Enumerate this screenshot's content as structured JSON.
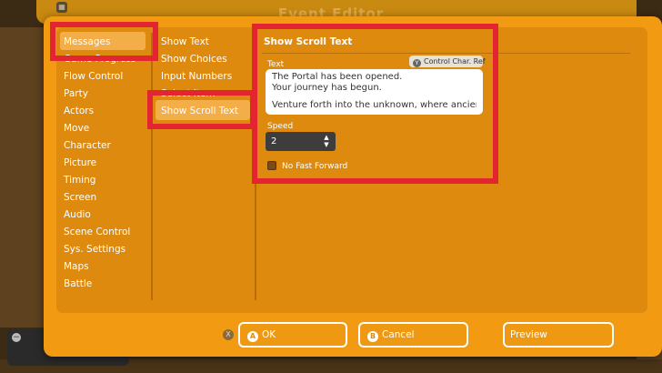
{
  "window": {
    "title": "Event Editor"
  },
  "categories": [
    "Messages",
    "Game Progress",
    "Flow Control",
    "Party",
    "Actors",
    "Move",
    "Character",
    "Picture",
    "Timing",
    "Screen",
    "Audio",
    "Scene Control",
    "Sys. Settings",
    "Maps",
    "Battle"
  ],
  "selected_category": "Messages",
  "commands": [
    "Show Text",
    "Show Choices",
    "Input Numbers",
    "Select Item",
    "Show Scroll Text"
  ],
  "selected_command": "Show Scroll Text",
  "detail": {
    "title": "Show Scroll Text",
    "text_label": "Text",
    "control_ref_button": "Control Char. Ref",
    "control_ref_glyph": "Y",
    "text_lines": [
      "The Portal has been opened.",
      "Your journey has begun.",
      "",
      "Venture forth into the unknown, where ancient …"
    ],
    "speed_label": "Speed",
    "speed_value": "2",
    "no_fast_forward_label": "No Fast Forward",
    "no_fast_forward_checked": false
  },
  "footer": {
    "close_glyph": "X",
    "ok_glyph": "A",
    "ok_label": "OK",
    "cancel_glyph": "B",
    "cancel_label": "Cancel",
    "preview_label": "Preview"
  },
  "colors": {
    "dialog_bg": "#f29a12",
    "panel_bg": "#de8a0e",
    "selection": "#f4ae49",
    "highlight": "#e22530"
  }
}
